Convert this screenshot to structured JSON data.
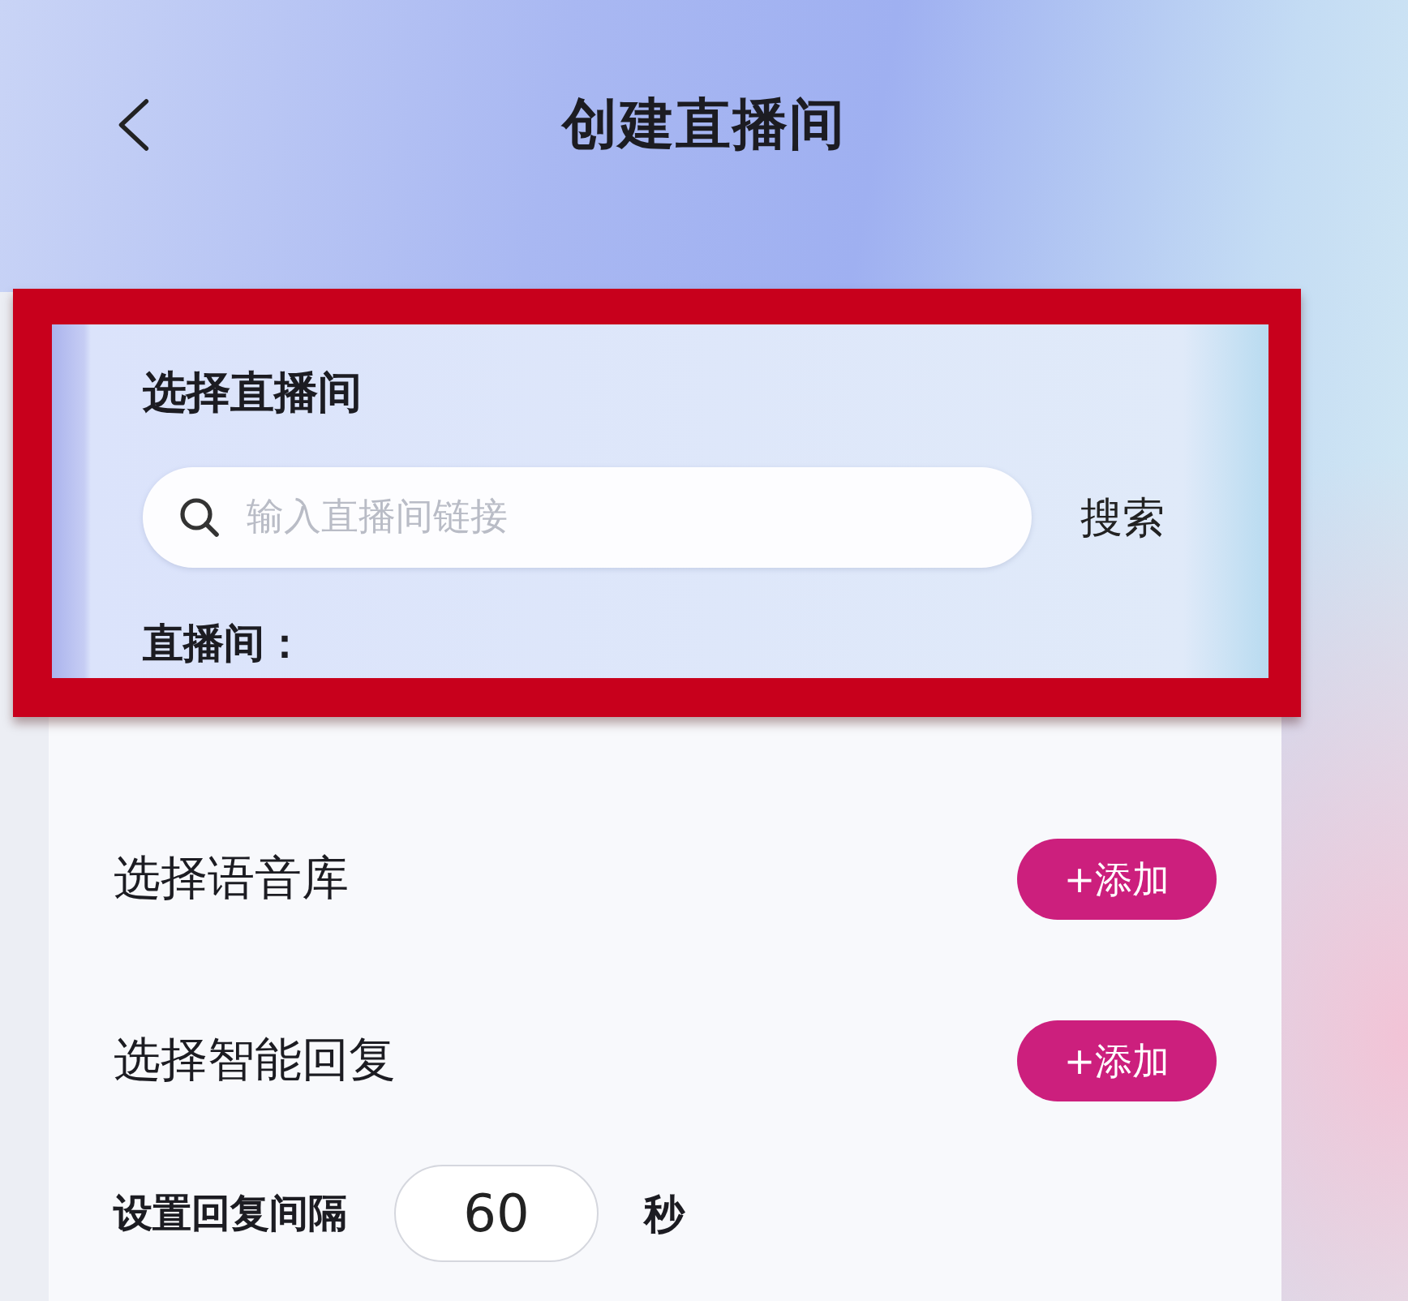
{
  "header": {
    "title": "创建直播间"
  },
  "live_room": {
    "title": "选择直播间",
    "search": {
      "placeholder": "输入直播间链接"
    },
    "search_button": "搜索",
    "room_label": "直播间：",
    "highlighted": true
  },
  "options": [
    {
      "kind": "add",
      "label": "选择语音库",
      "button": "+添加"
    },
    {
      "kind": "add",
      "label": "选择智能回复",
      "button": "+添加"
    },
    {
      "kind": "interval",
      "label": "设置回复间隔",
      "value": "60",
      "unit": "秒"
    }
  ]
}
